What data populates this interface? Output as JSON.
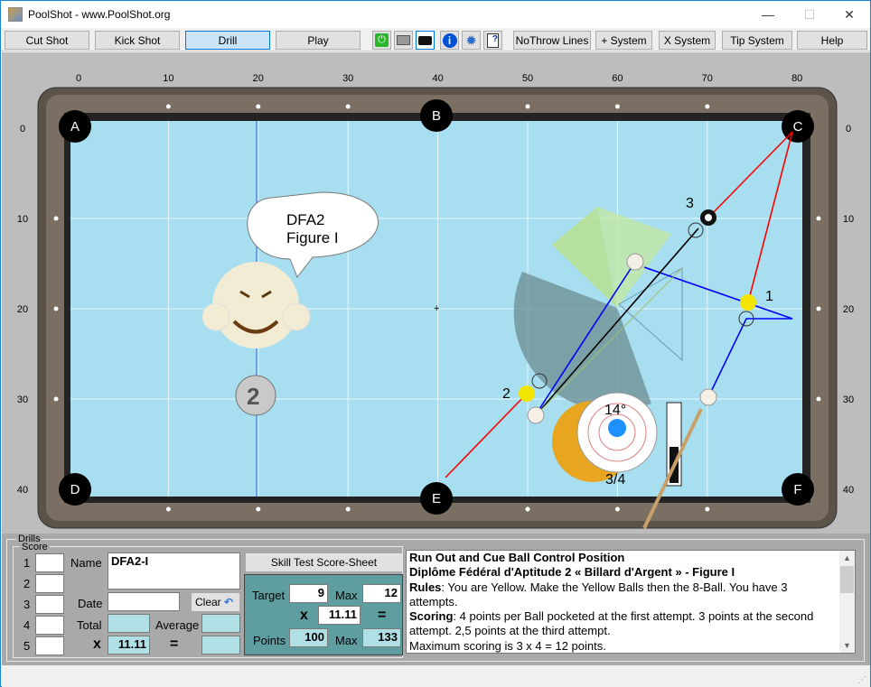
{
  "window": {
    "title": "PoolShot - www.PoolShot.org",
    "minimize": "—",
    "maximize": "☐",
    "close": "✕"
  },
  "toolbar": {
    "buttons": [
      {
        "label": "Cut Shot"
      },
      {
        "label": "Kick Shot"
      },
      {
        "label": "Drill",
        "selected": true
      },
      {
        "label": "Play"
      }
    ],
    "icons": [
      "power-icon",
      "printer-icon",
      "camera-icon",
      "info-icon",
      "gear-icon",
      "help-document-icon"
    ],
    "right_buttons": [
      {
        "label": "NoThrow Lines"
      },
      {
        "label": "+ System"
      },
      {
        "label": "X System"
      },
      {
        "label": "Tip System"
      },
      {
        "label": "Help"
      }
    ]
  },
  "table": {
    "x_ticks": [
      "0",
      "10",
      "20",
      "30",
      "40",
      "50",
      "60",
      "70",
      "80"
    ],
    "y_ticks": [
      "0",
      "10",
      "20",
      "30",
      "40"
    ],
    "pockets": [
      "A",
      "B",
      "C",
      "D",
      "E",
      "F"
    ],
    "ball_labels": {
      "ball1": "1",
      "ball2": "2",
      "ball3": "3"
    },
    "speech": {
      "line1": "DFA2",
      "line2": "Figure I"
    },
    "medal": "2",
    "cue_angle": "14°",
    "cue_tip": "3/4",
    "power_level": 0.45,
    "colors": {
      "cloth": "#a8dff0",
      "yellow": "#f2e600",
      "red": "#ff0000",
      "blue": "#0000ff"
    }
  },
  "drills": {
    "group_label": "Drills",
    "score_label": "Score",
    "rows": [
      "1",
      "2",
      "3",
      "4",
      "5"
    ],
    "name_label": "Name",
    "name_value": "DFA2-I",
    "date_label": "Date",
    "date_value": "",
    "clear_label": "Clear",
    "total_label": "Total",
    "total_value": "",
    "average_label": "Average",
    "average_value": "",
    "x_label": "x",
    "multiplier": "11.11",
    "eq_label": "=",
    "result_value": "",
    "score_sheet_label": "Skill Test Score-Sheet",
    "target_label": "Target",
    "target_value": "9",
    "max_label": "Max",
    "max_value": "12",
    "multiplier2": "11.11",
    "points_label": "Points",
    "points_value": "100",
    "points_max_label": "Max",
    "points_max_value": "133"
  },
  "description": {
    "title": "Run Out and Cue Ball Control Position",
    "subtitle": "Diplôme Fédéral d'Aptitude 2 « Billard d'Argent » - Figure I",
    "rules_label": "Rules",
    "rules_text": ": You are Yellow. Make the Yellow Balls then the 8-Ball. You have 3 attempts.",
    "scoring_label": "Scoring",
    "scoring_text": ": 4 points per Ball pocketed at the first attempt. 3 points at the second attempt. 2,5 points at the third attempt.",
    "max_text": "Maximum scoring is 3 x 4 = 12 points."
  }
}
